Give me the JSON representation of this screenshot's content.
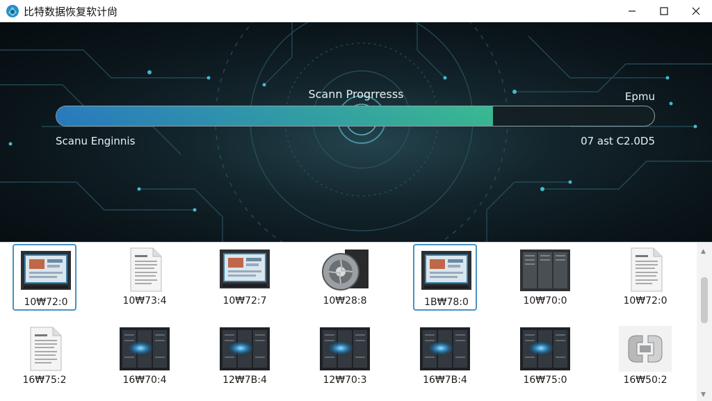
{
  "window": {
    "title": "比特数据恢复软计尙",
    "icon": "app-logo-icon",
    "controls": [
      "minimize-icon",
      "maximize-icon",
      "close-icon"
    ]
  },
  "scan": {
    "progress_title": "Scann Progrresss",
    "right_label": "Epmu",
    "status_left": "Scanu Enginnis",
    "status_right": "07 ast C2.0D5",
    "progress": 0.73,
    "accent": "#2f9bb0"
  },
  "files": [
    {
      "label": "10₩72:0",
      "icon": "monitor-icon",
      "selected": true
    },
    {
      "label": "10₩73:4",
      "icon": "document-icon",
      "selected": false
    },
    {
      "label": "10₩72:7",
      "icon": "monitor-icon",
      "selected": false
    },
    {
      "label": "10₩28:8",
      "icon": "engine-icon",
      "selected": false
    },
    {
      "label": "1B₩78:0",
      "icon": "monitor-icon",
      "selected": true
    },
    {
      "label": "10₩70:0",
      "icon": "server-icon",
      "selected": false
    },
    {
      "label": "10₩72:0",
      "icon": "document-icon",
      "selected": false
    },
    {
      "label": "16₩75:2",
      "icon": "document-icon",
      "selected": false
    },
    {
      "label": "16₩70:4",
      "icon": "server-glow-icon",
      "selected": false
    },
    {
      "label": "12₩7B:4",
      "icon": "server-glow-icon",
      "selected": false
    },
    {
      "label": "12₩70:3",
      "icon": "server-glow-icon",
      "selected": false
    },
    {
      "label": "16₩7B:4",
      "icon": "server-glow-icon",
      "selected": false
    },
    {
      "label": "16₩75:0",
      "icon": "server-glow-icon",
      "selected": false
    },
    {
      "label": "16₩50:2",
      "icon": "bracket-icon",
      "selected": false
    }
  ]
}
